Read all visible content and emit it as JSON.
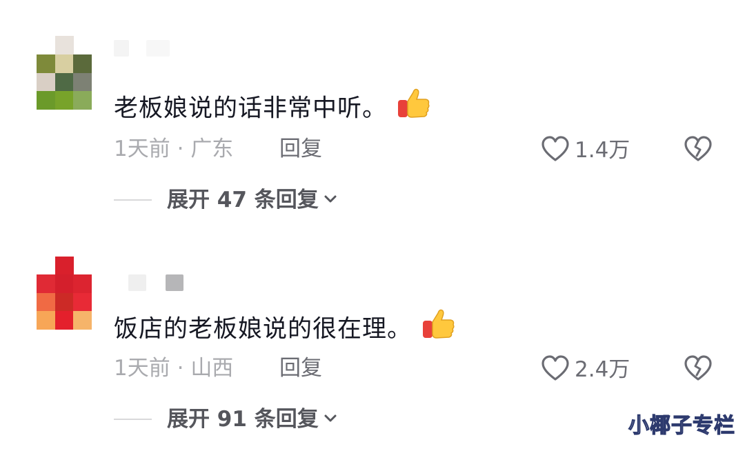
{
  "comments": [
    {
      "text": "老板娘说的话非常中听。",
      "time": "1天前",
      "separator": "·",
      "location": "广东",
      "reply_label": "回复",
      "likes": "1.4万",
      "expand_label": "展开 47 条回复",
      "avatar_icon": "pixelated-avatar",
      "emoji_icon": "thumbs-up-icon"
    },
    {
      "text": "饭店的老板娘说的很在理。",
      "time": "1天前",
      "separator": "·",
      "location": "山西",
      "reply_label": "回复",
      "likes": "2.4万",
      "expand_label": "展开 91 条回复",
      "avatar_icon": "pixelated-avatar",
      "emoji_icon": "thumbs-up-icon"
    }
  ],
  "watermark": "小椰子专栏",
  "colors": {
    "text_primary": "#161823",
    "text_secondary": "#a9aaae",
    "text_action": "#6b6c73",
    "thumb_yellow": "#ffc83d",
    "thumb_red": "#e8413a"
  }
}
